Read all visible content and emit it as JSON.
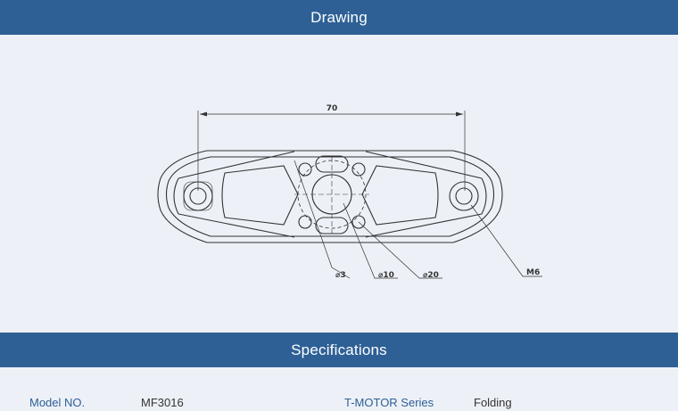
{
  "drawing": {
    "header": "Drawing",
    "dimensions": {
      "length": "70",
      "hole_small": "⌀3",
      "hole_mid": "⌀10",
      "hole_center": "⌀20",
      "thread": "M6"
    }
  },
  "specifications": {
    "header": "Specifications",
    "rows": [
      {
        "label": "Model NO.",
        "value": "MF3016"
      },
      {
        "label": "T-MOTOR Series",
        "value": "Folding"
      }
    ]
  },
  "colors": {
    "header_bg": "#2e6096",
    "page_bg": "#edf1f7",
    "label_text": "#2e6096"
  }
}
